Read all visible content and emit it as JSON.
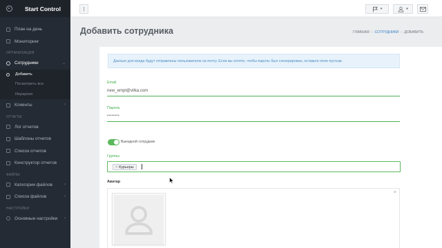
{
  "app": {
    "title": "Start Control"
  },
  "sidebar": {
    "top_items": [
      {
        "label": "План на день",
        "icon": "calendar-icon"
      },
      {
        "label": "Мониторинг",
        "icon": "monitor-icon"
      }
    ],
    "sections": {
      "organization": "ОРГАНИЗАЦИЯ",
      "reports": "ОТЧЕТЫ",
      "files": "ФАЙЛЫ",
      "settings": "НАСТРОЙКИ"
    },
    "employees": {
      "label": "Сотрудники",
      "icon": "user-icon"
    },
    "employees_sub": [
      {
        "label": "Добавить"
      },
      {
        "label": "Посмотреть все"
      },
      {
        "label": "Иерархия"
      }
    ],
    "clients": {
      "label": "Клиенты",
      "icon": "heart-icon"
    },
    "report_items": [
      {
        "label": "Лог отчетов",
        "icon": "list-icon"
      },
      {
        "label": "Шаблоны отчетов",
        "icon": "template-icon"
      },
      {
        "label": "Список отчетов",
        "icon": "document-icon"
      },
      {
        "label": "Конструктор отчетов",
        "icon": "builder-icon"
      }
    ],
    "file_items": [
      {
        "label": "Категории файлов",
        "icon": "folder-icon"
      },
      {
        "label": "Список файлов",
        "icon": "file-icon"
      }
    ],
    "settings_items": [
      {
        "label": "Основные настройки",
        "icon": "gear-icon"
      }
    ]
  },
  "page": {
    "title": "Добавить сотрудника",
    "breadcrumb": [
      "ГЛАВНАЯ",
      "СОТРУДНИКИ",
      "ДОБАВИТЬ"
    ]
  },
  "form": {
    "info": "Данные для входа будут отправлены пользователю на почту. Если вы хотите, чтобы пароль был сгенерирован, оставьте поле пустым.",
    "email_label": "Email",
    "email_value": "new_empl@vilka.com",
    "password_label": "Пароль",
    "password_value": "••••••••",
    "toggle_label": "Выездной сотрудник",
    "toggle_on": true,
    "groups_label": "Группы",
    "groups_tag": "Курьеры",
    "groups_tag_remove": "×",
    "avatar_label": "Аватар",
    "avatar_remove": "×"
  },
  "colors": {
    "sidebar": "#252b34",
    "accent_green": "#4caf50",
    "info_bg": "#e7f2fb",
    "link": "#3b82c4"
  }
}
